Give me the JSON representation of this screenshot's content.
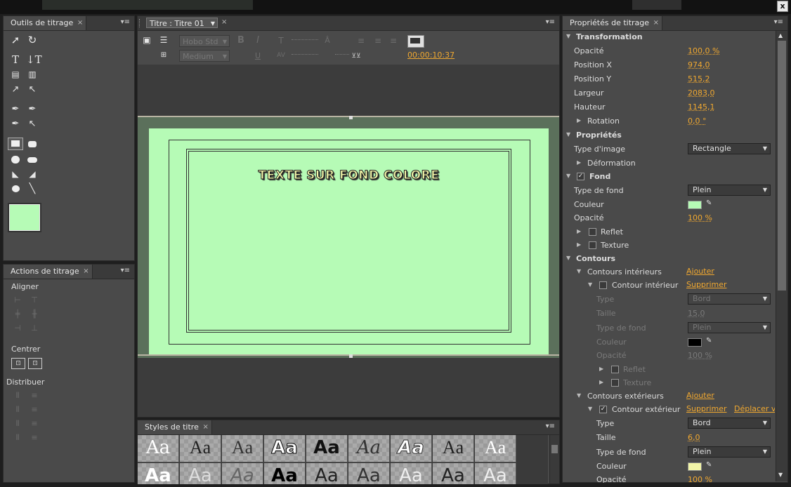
{
  "window": {
    "close_glyph": "x"
  },
  "tools_panel": {
    "title": "Outils de titrage",
    "close": "×",
    "menu": "▾≡"
  },
  "actions_panel": {
    "title": "Actions de titrage",
    "close": "×",
    "menu": "▾≡",
    "align_label": "Aligner",
    "center_label": "Centrer",
    "distribute_label": "Distribuer"
  },
  "title_panel": {
    "tab": "Titre : Titre 01",
    "close": "×",
    "menu": "▾≡",
    "font_family": "Hobo Std",
    "font_style": "Medium",
    "timecode": "00:00:10:37",
    "canvas_text": "TEXTE SUR FOND COLORE",
    "fill_color": "#b6fbb6"
  },
  "styles_panel": {
    "title": "Styles de titre",
    "close": "×",
    "menu": "▾≡",
    "samples_row1": [
      "Aa",
      "Aa",
      "Aa",
      "Aa",
      "Aa",
      "Aa",
      "Aa",
      "Aa",
      "Aa"
    ],
    "samples_row2": [
      "Aa",
      "Aa",
      "Aa",
      "Aa",
      "Aa",
      "Aa",
      "Aa",
      "Aa",
      "Aa"
    ]
  },
  "props_panel": {
    "title": "Propriétés de titrage",
    "close": "×",
    "menu": "▾≡",
    "transformation": {
      "header": "Transformation",
      "opacity_label": "Opacité",
      "opacity": "100,0 %",
      "posx_label": "Position X",
      "posx": "974,0",
      "posy_label": "Position Y",
      "posy": "515,2",
      "width_label": "Largeur",
      "width": "2083,0",
      "height_label": "Hauteur",
      "height": "1145,1",
      "rotation_label": "Rotation",
      "rotation": "0,0 °"
    },
    "properties": {
      "header": "Propriétés",
      "image_type_label": "Type d'image",
      "image_type": "Rectangle",
      "distortion_label": "Déformation"
    },
    "fill": {
      "header": "Fond",
      "fill_type_label": "Type de fond",
      "fill_type": "Plein",
      "color_label": "Couleur",
      "color": "#b6fbb6",
      "opacity_label": "Opacité",
      "opacity": "100 %",
      "sheen_label": "Reflet",
      "texture_label": "Texture"
    },
    "strokes": {
      "header": "Contours",
      "inner_label": "Contours intérieurs",
      "add": "Ajouter",
      "inner_item": "Contour intérieur",
      "delete": "Supprimer",
      "inner_type_label": "Type",
      "inner_type": "Bord",
      "inner_size_label": "Taille",
      "inner_size": "15,0",
      "inner_fill_type_label": "Type de fond",
      "inner_fill_type": "Plein",
      "inner_color_label": "Couleur",
      "inner_color": "#000000",
      "inner_opacity_label": "Opacité",
      "inner_opacity": "100 %",
      "inner_sheen_label": "Reflet",
      "inner_texture_label": "Texture",
      "outer_label": "Contours extérieurs",
      "outer_add": "Ajouter",
      "outer_item": "Contour extérieur",
      "outer_delete": "Supprimer",
      "outer_move": "Déplacer ve",
      "outer_type_label": "Type",
      "outer_type": "Bord",
      "outer_size_label": "Taille",
      "outer_size": "6,0",
      "outer_fill_type_label": "Type de fond",
      "outer_fill_type": "Plein",
      "outer_color_label": "Couleur",
      "outer_color": "#f2f5a8",
      "outer_opacity_label": "Opacité",
      "outer_opacity": "100 %"
    }
  }
}
